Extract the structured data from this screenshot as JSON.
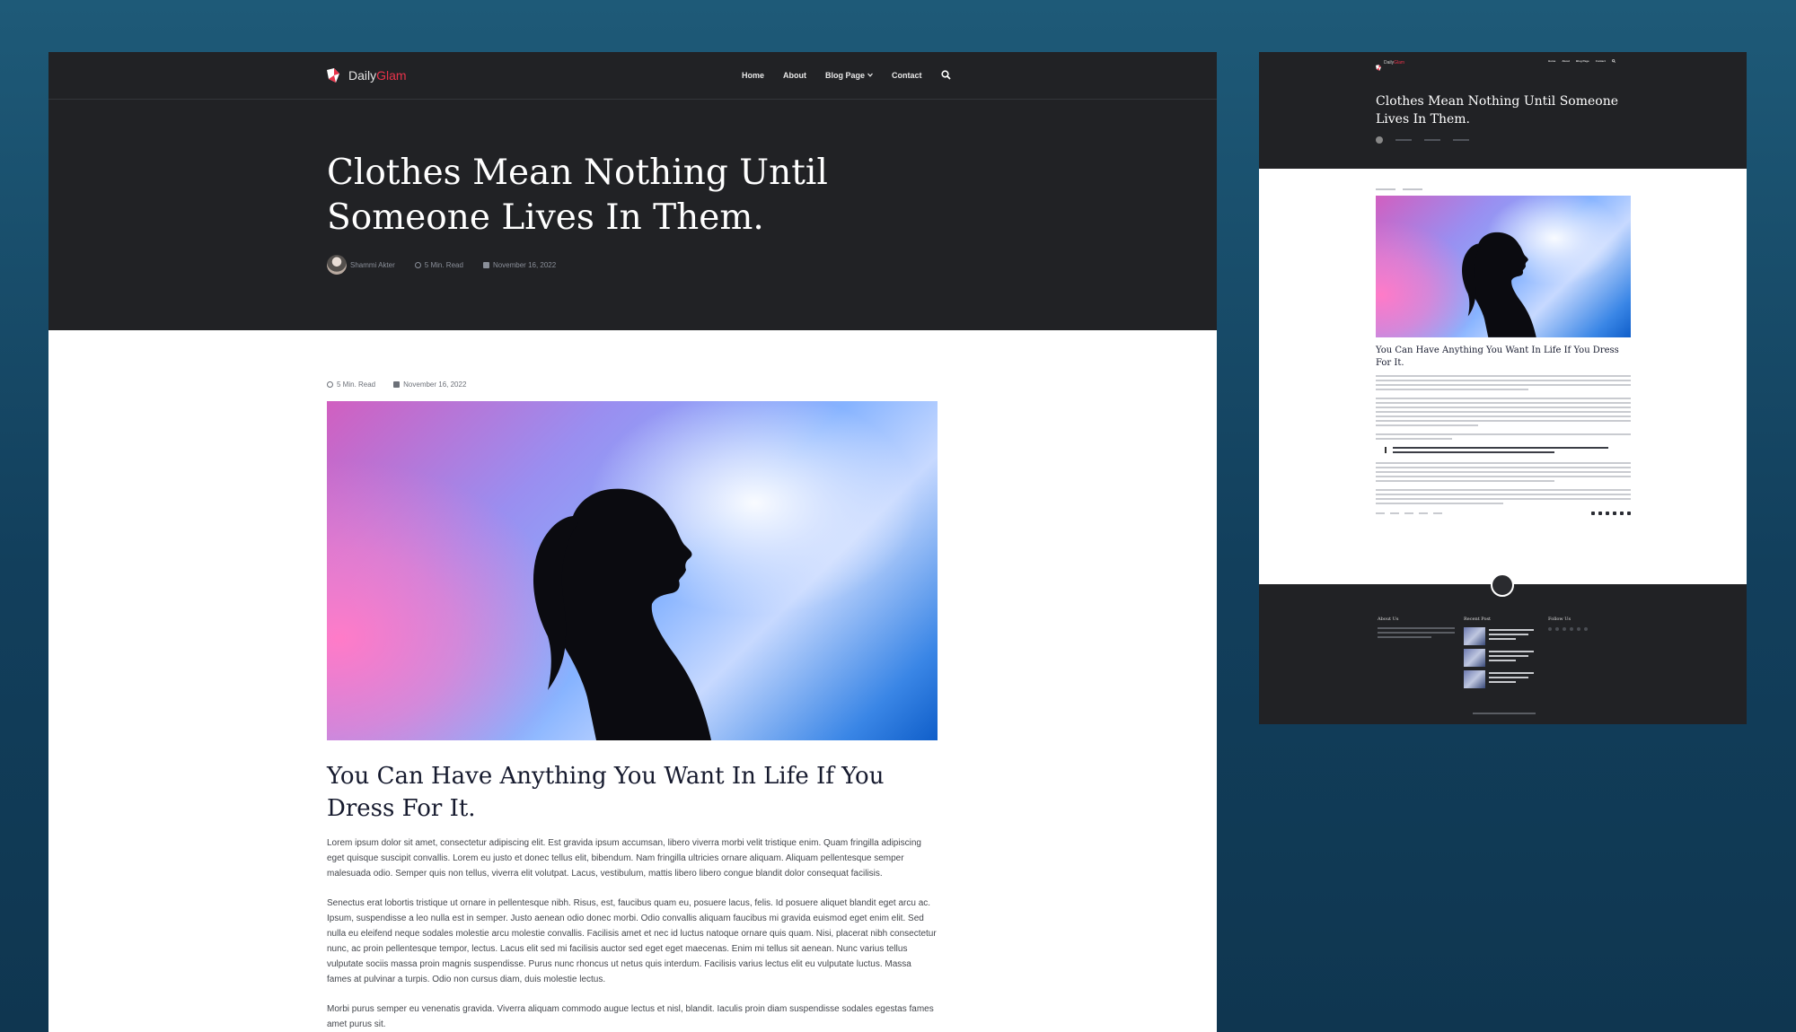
{
  "brand": {
    "name_prefix": "Daily",
    "name_accent": "Glam",
    "accent_color": "#e8334a"
  },
  "nav": {
    "items": [
      {
        "label": "Home"
      },
      {
        "label": "About"
      },
      {
        "label": "Blog Page",
        "icon": "chevron-down-icon"
      },
      {
        "label": "Contact"
      }
    ],
    "search_icon": "search-icon"
  },
  "post": {
    "title": "Clothes Mean Nothing Until Someone Lives In Them.",
    "author": "Shammi Akter",
    "read_time": "5 Min. Read",
    "date": "November 16, 2022"
  },
  "article": {
    "read_time": "5 Min. Read",
    "date": "November 16, 2022",
    "heading": "You Can Have Anything You Want In Life If You Dress For It.",
    "paragraphs": [
      "Lorem ipsum dolor sit amet, consectetur adipiscing elit. Est gravida ipsum accumsan, libero viverra morbi velit tristique enim. Quam fringilla adipiscing eget quisque suscipit convallis. Lorem eu justo et donec tellus elit, bibendum. Nam fringilla ultricies ornare aliquam. Aliquam pellentesque semper malesuada odio. Semper quis non tellus, viverra elit volutpat. Lacus, vestibulum, mattis libero libero congue blandit dolor consequat facilisis.",
      "Senectus erat lobortis tristique ut ornare in pellentesque nibh. Risus, est, faucibus quam eu, posuere lacus, felis. Id posuere aliquet blandit eget arcu ac. Ipsum, suspendisse a leo nulla est in semper. Justo aenean odio donec morbi. Odio convallis aliquam faucibus mi gravida euismod eget enim elit. Sed nulla eu eleifend neque sodales molestie arcu molestie convallis. Facilisis amet et nec id luctus natoque ornare quis quam. Nisi, placerat nibh consectetur nunc, ac proin pellentesque tempor, lectus. Lacus elit sed mi facilisis auctor sed eget eget maecenas. Enim mi tellus sit aenean. Nunc varius tellus vulputate sociis massa proin magnis suspendisse. Purus nunc rhoncus ut netus quis interdum. Facilisis varius lectus elit eu vulputate luctus. Massa fames at pulvinar a turpis. Odio non cursus diam, duis molestie lectus.",
      "Morbi purus semper eu venenatis gravida. Viverra aliquam commodo augue lectus et nisl, blandit. Iaculis proin diam suspendisse sodales egestas fames amet purus sit."
    ]
  },
  "preview": {
    "title": "Clothes Mean Nothing Until Someone Lives In Them.",
    "heading": "You Can Have Anything You Want In Life If You Dress For It.",
    "footer": {
      "about_heading": "About Us",
      "recent_heading": "Recent Post",
      "follow_heading": "Follow Us"
    }
  }
}
